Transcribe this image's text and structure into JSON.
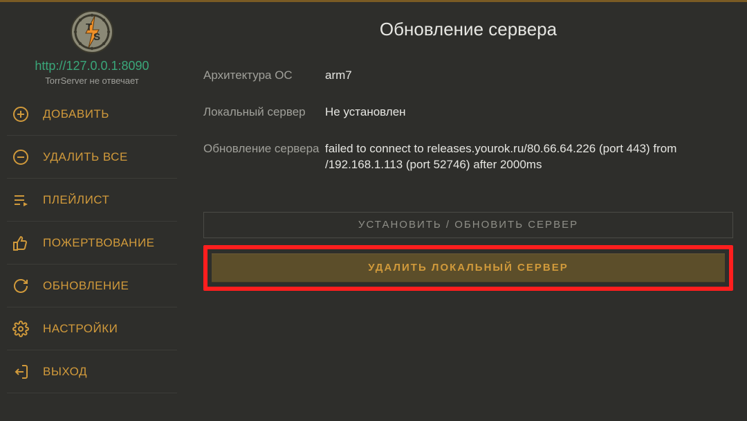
{
  "sidebar": {
    "server_url": "http://127.0.0.1:8090",
    "server_status": "TorrServer не отвечает",
    "items": [
      {
        "label": "ДОБАВИТЬ"
      },
      {
        "label": "УДАЛИТЬ ВСЕ"
      },
      {
        "label": "ПЛЕЙЛИСТ"
      },
      {
        "label": "ПОЖЕРТВОВАНИЕ"
      },
      {
        "label": "ОБНОВЛЕНИЕ"
      },
      {
        "label": "НАСТРОЙКИ"
      },
      {
        "label": "ВЫХОД"
      }
    ]
  },
  "main": {
    "title": "Обновление сервера",
    "rows": [
      {
        "label": "Архитектура ОС",
        "value": "arm7"
      },
      {
        "label": "Локальный сервер",
        "value": "Не установлен"
      },
      {
        "label": "Обновление сервера",
        "value": "failed to connect to releases.yourok.ru/80.66.64.226 (port 443) from /192.168.1.113 (port 52746) after 2000ms"
      }
    ],
    "install_button": "УСТАНОВИТЬ / ОБНОВИТЬ СЕРВЕР",
    "delete_button": "УДАЛИТЬ ЛОКАЛЬНЫЙ СЕРВЕР"
  }
}
